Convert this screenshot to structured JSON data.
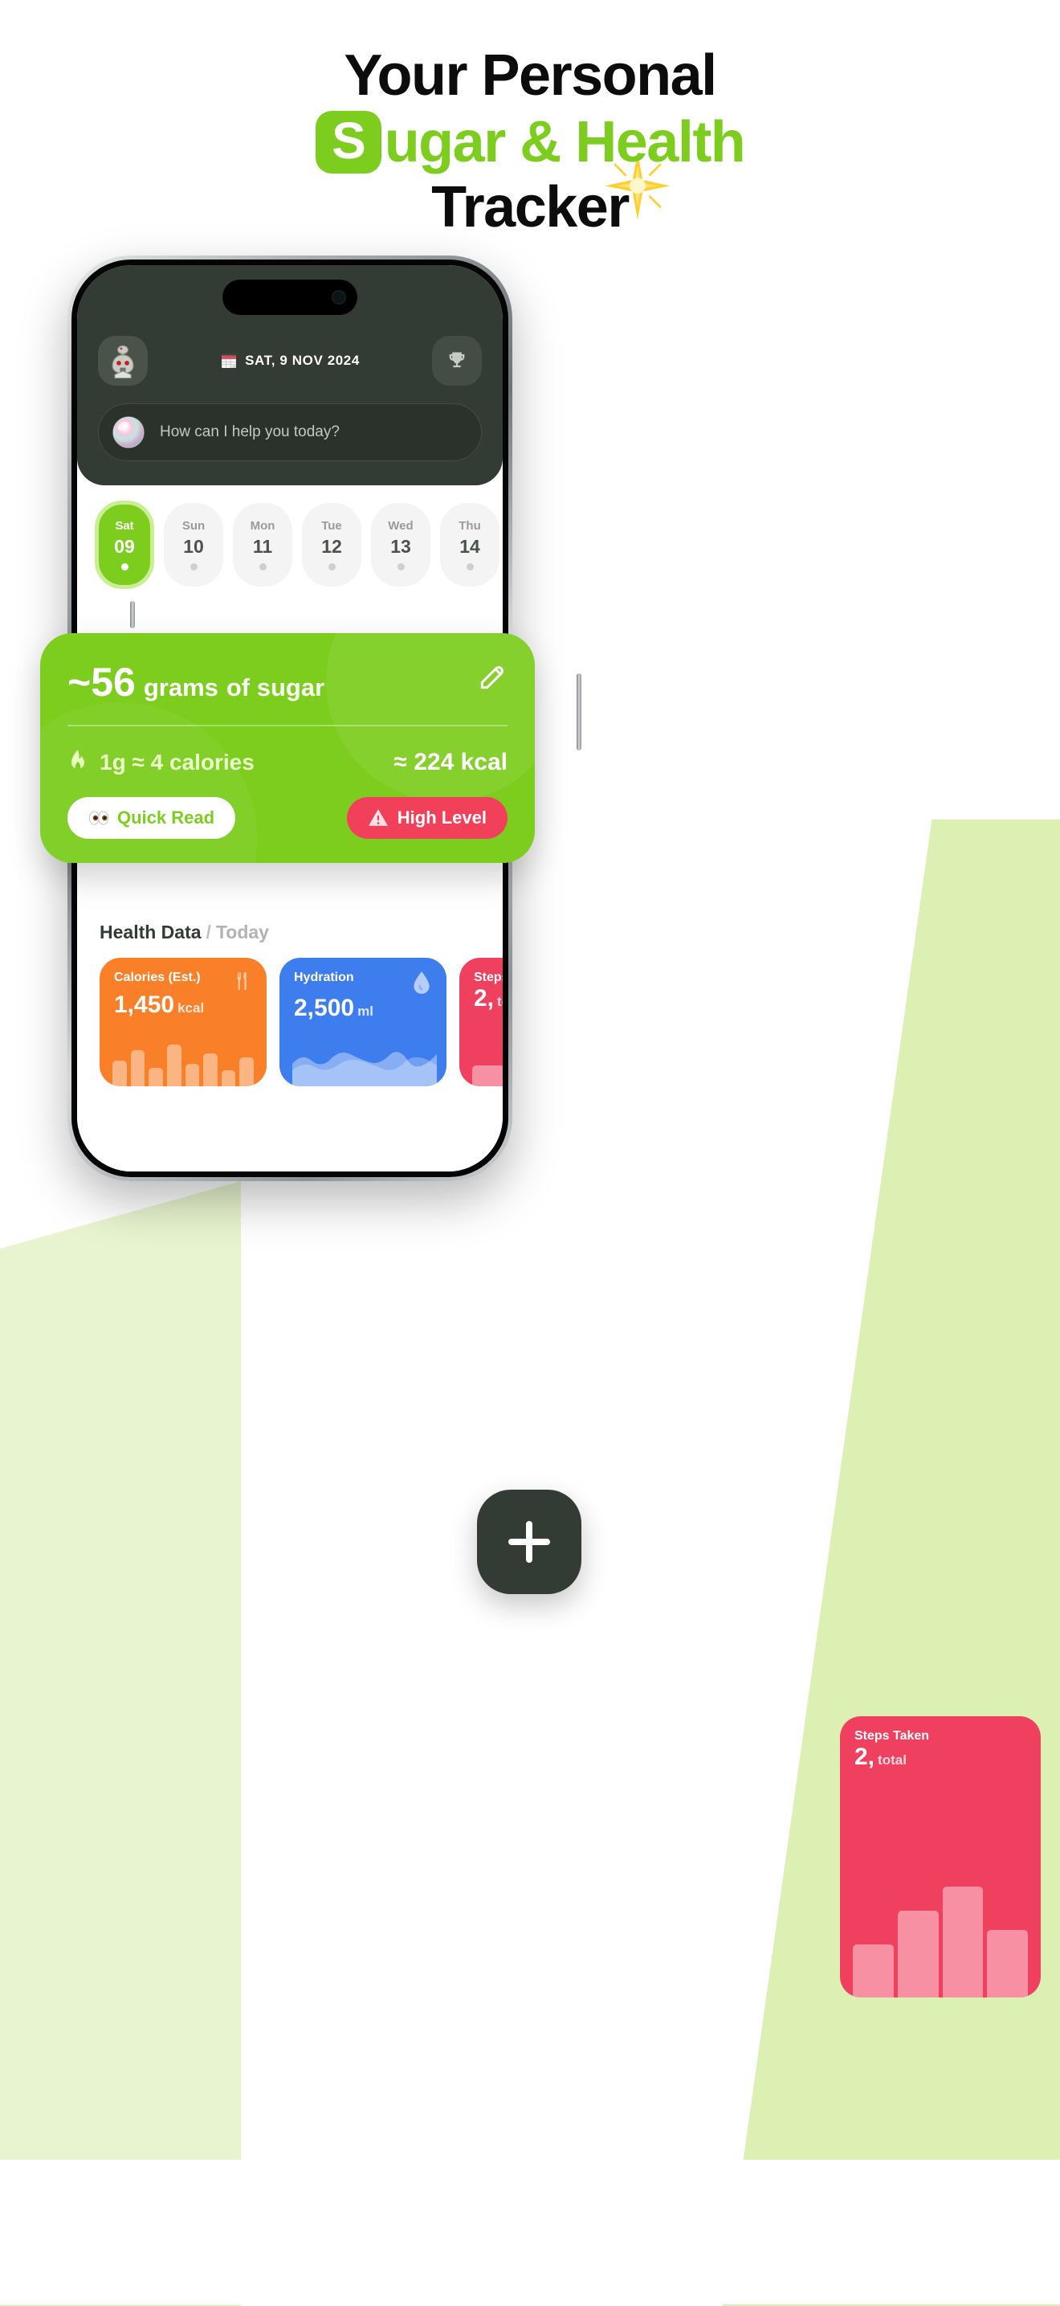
{
  "hero": {
    "line1": "Your Personal",
    "badge_letter": "S",
    "line2_rest": "ugar & Health",
    "line3": "Tracker",
    "accent_green": "#7dcd1e",
    "sparkle_icon": "sparkle-icon"
  },
  "phone": {
    "header": {
      "avatar_icon": "robot-avatar",
      "date_icon": "calendar-emoji",
      "date": "SAT, 9 NOV 2024",
      "trophy_icon": "trophy-icon",
      "assistant": {
        "orb_icon": "ai-orb-icon",
        "placeholder": "How can I help you today?"
      }
    },
    "days": [
      {
        "dow": "Sat",
        "num": "09",
        "active": true
      },
      {
        "dow": "Sun",
        "num": "10",
        "active": false
      },
      {
        "dow": "Mon",
        "num": "11",
        "active": false
      },
      {
        "dow": "Tue",
        "num": "12",
        "active": false
      },
      {
        "dow": "Wed",
        "num": "13",
        "active": false
      },
      {
        "dow": "Thu",
        "num": "14",
        "active": false
      }
    ],
    "sugar_card": {
      "approx": "~",
      "amount": "56",
      "grams_label": "grams",
      "of_label": "of sugar",
      "edit_icon": "edit-pencil-icon",
      "flame_icon": "flame-icon",
      "conversion": "1g ≈ 4 calories",
      "kcal": "≈ 224 kcal",
      "quick_read_icon": "eyes-emoji",
      "quick_read_label": "Quick Read",
      "warning_icon": "warning-triangle-icon",
      "level_label": "High Level",
      "bg_color": "#7dcd1e",
      "level_color": "#f2405a"
    },
    "fab": {
      "icon": "plus-icon"
    },
    "health_section": {
      "title": "Health Data",
      "separator": "/",
      "subtitle": "Today"
    },
    "stats": [
      {
        "label": "Calories (Est.)",
        "value": "1,450",
        "unit": "kcal",
        "icon": "fork-knife-icon",
        "color": "#f98028",
        "viz": "bars"
      },
      {
        "label": "Hydration",
        "value": "2,500",
        "unit": "ml",
        "icon": "water-drop-icon",
        "color": "#3e7dee",
        "viz": "wave"
      },
      {
        "label": "Steps Taken",
        "value": "2,",
        "unit": "total",
        "icon": "footsteps-icon",
        "color": "#ef4060",
        "viz": "bars"
      }
    ],
    "nav": [
      {
        "icon": "home-icon",
        "active": true
      },
      {
        "icon": "trophy-icon",
        "active": false
      },
      {
        "icon": "ai-orb-icon",
        "active": false
      },
      {
        "icon": "lightbulb-icon",
        "active": false
      },
      {
        "icon": "person-icon",
        "active": false
      }
    ]
  }
}
